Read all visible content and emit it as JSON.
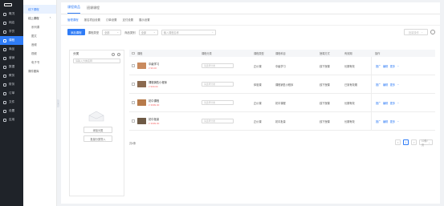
{
  "sidebar": {
    "items": [
      {
        "label": "概况",
        "icon": "grid-icon"
      },
      {
        "label": "网店",
        "icon": "store-icon"
      },
      {
        "label": "学员",
        "icon": "user-icon"
      },
      {
        "label": "课程",
        "icon": "book-icon",
        "active": true
      },
      {
        "label": "商品",
        "icon": "bag-icon"
      },
      {
        "label": "营销",
        "icon": "megaphone-icon"
      },
      {
        "label": "数据",
        "icon": "chart-icon"
      },
      {
        "label": "教务",
        "icon": "calendar-icon"
      },
      {
        "label": "财务",
        "icon": "wallet-icon"
      },
      {
        "label": "订单",
        "icon": "receipt-icon"
      },
      {
        "label": "文件",
        "icon": "folder-icon"
      },
      {
        "label": "设置",
        "icon": "gear-icon"
      },
      {
        "label": "应用",
        "icon": "apps-icon"
      }
    ]
  },
  "subnav": {
    "items": [
      {
        "label": "线下课程",
        "type": "item",
        "active": true
      },
      {
        "label": "线上课程",
        "type": "group"
      },
      {
        "label": "系列课",
        "type": "child"
      },
      {
        "label": "图文",
        "type": "child"
      },
      {
        "label": "音频",
        "type": "child"
      },
      {
        "label": "视频",
        "type": "child"
      },
      {
        "label": "电子书",
        "type": "child"
      },
      {
        "label": "课件题库",
        "type": "item"
      }
    ]
  },
  "tabs": {
    "items": [
      "课程商品",
      "班课课程"
    ]
  },
  "subtabs": {
    "items": [
      "管理课程",
      "报名项目设置",
      "订单设置",
      "支付设置",
      "展示设置"
    ]
  },
  "toolbar": {
    "add_label": "添加课程",
    "type_label": "课程类型",
    "type_value": "全部",
    "status_label": "商品类别",
    "status_value": "全部",
    "search_placeholder": "输入课程名称",
    "batch_label": "批量操作"
  },
  "category": {
    "title": "分类",
    "search_placeholder": "请输入分类名称",
    "add_label": "添加分类",
    "import_label": "批量分类导入"
  },
  "table": {
    "headers": [
      "课程",
      "课程分类",
      "课程类型",
      "课程科目",
      "授课方式",
      "有效期",
      "操作"
    ],
    "rows": [
      {
        "name": "中级学习",
        "price": "¥ 99.00",
        "category_placeholder": "请选择分类",
        "type": "正价课",
        "subject": "中级学习",
        "mode": "线下授课",
        "time": "长期有效",
        "thumb": "#c98a5e"
      },
      {
        "name": "课程销售小程序",
        "price": "¥ 999.00",
        "category_placeholder": "请选择分类",
        "type": "体验课",
        "subject": "课程销售小程序",
        "mode": "线下授课",
        "time": "已到有效期",
        "thumb": "#8b6a4f"
      },
      {
        "name": "初中课程",
        "price": "¥ 3999.00",
        "category_placeholder": "请选择分类",
        "type": "正价课",
        "subject": "初中课程",
        "mode": "线下授课",
        "time": "长期有效",
        "thumb": "#b77a4a"
      },
      {
        "name": "初中批量",
        "price": "¥ 3999.00",
        "category_placeholder": "请选择分类",
        "type": "正价课",
        "subject": "初中批量",
        "mode": "线下授课",
        "time": "长期有效",
        "thumb": "#6e5a46"
      }
    ],
    "ops": [
      "推广",
      "编辑",
      "更多"
    ]
  },
  "footer": {
    "summary": "共4条",
    "prev": "<",
    "page": "1",
    "next": ">",
    "page_size": "10条/页"
  }
}
